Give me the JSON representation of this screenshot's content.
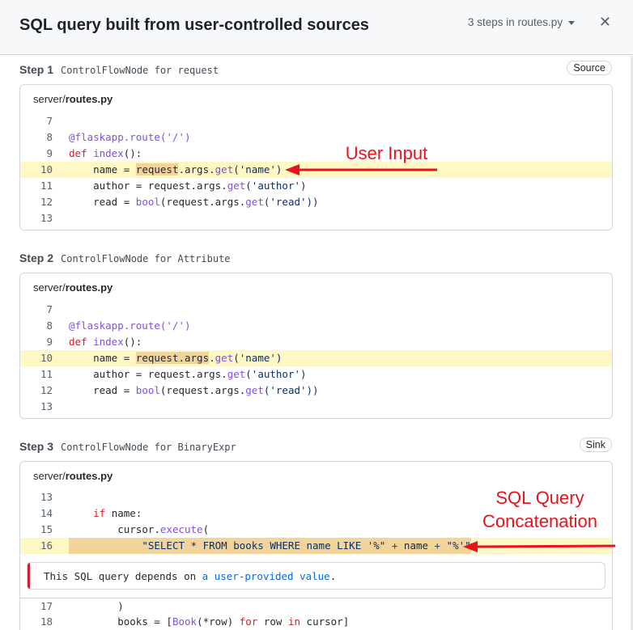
{
  "header": {
    "title": "SQL query built from user-controlled sources",
    "steps_select": "3 steps in routes.py",
    "close_glyph": "✕"
  },
  "steps": [
    {
      "label": "Step 1",
      "description": "ControlFlowNode for request",
      "badge": "Source",
      "file_dir": "server/",
      "file_name": "routes.py",
      "lines": [
        {
          "n": "7"
        },
        {
          "n": "8"
        },
        {
          "n": "9"
        },
        {
          "n": "10"
        },
        {
          "n": "11"
        },
        {
          "n": "12"
        },
        {
          "n": "13"
        }
      ]
    },
    {
      "label": "Step 2",
      "description": "ControlFlowNode for Attribute",
      "badge": "",
      "file_dir": "server/",
      "file_name": "routes.py",
      "lines": [
        {
          "n": "7"
        },
        {
          "n": "8"
        },
        {
          "n": "9"
        },
        {
          "n": "10"
        },
        {
          "n": "11"
        },
        {
          "n": "12"
        },
        {
          "n": "13"
        }
      ]
    },
    {
      "label": "Step 3",
      "description": "ControlFlowNode for BinaryExpr",
      "badge": "Sink",
      "file_dir": "server/",
      "file_name": "routes.py",
      "lines": [
        {
          "n": "13"
        },
        {
          "n": "14"
        },
        {
          "n": "15"
        },
        {
          "n": "16"
        },
        {
          "n": "17"
        },
        {
          "n": "18"
        }
      ],
      "alert": {
        "prefix": "This SQL query depends on ",
        "link": "a user-provided value",
        "suffix": "."
      }
    }
  ],
  "code": {
    "decorator": "@flaskapp.route('/')",
    "def_kw": "def",
    "def_fn": "index",
    "def_rest": "():",
    "name_lhs": "name = ",
    "request": "request",
    "request_args": "request.args",
    "args_dot": ".args.",
    "dot": ".",
    "get": "get",
    "name_arg": "('name')",
    "author_lhs": "author = request.args.",
    "author_arg": "('author')",
    "read_lhs": "read = ",
    "bool": "bool",
    "read_mid": "(request.args.",
    "read_arg": "('read'))",
    "if_kw": "if",
    "if_rest": " name:",
    "cursor": "cursor.",
    "execute": "execute",
    "paren_open": "(",
    "sql_str": "\"SELECT * FROM books WHERE name LIKE '%\"",
    "plus1": " + ",
    "name_var": "name",
    "plus2": " + ",
    "pct_str": "\"%'\"",
    "close_paren": ")",
    "books_lhs": "books = [",
    "book_fn": "Book",
    "star_row": "(*row) ",
    "for_kw": "for",
    "row": " row ",
    "in_kw": "in",
    "cursor_end": " cursor]"
  },
  "annotations": {
    "user_input": "User Input",
    "sql_line1": "SQL Query",
    "sql_line2": "Concatenation",
    "color": "#e8121b"
  }
}
